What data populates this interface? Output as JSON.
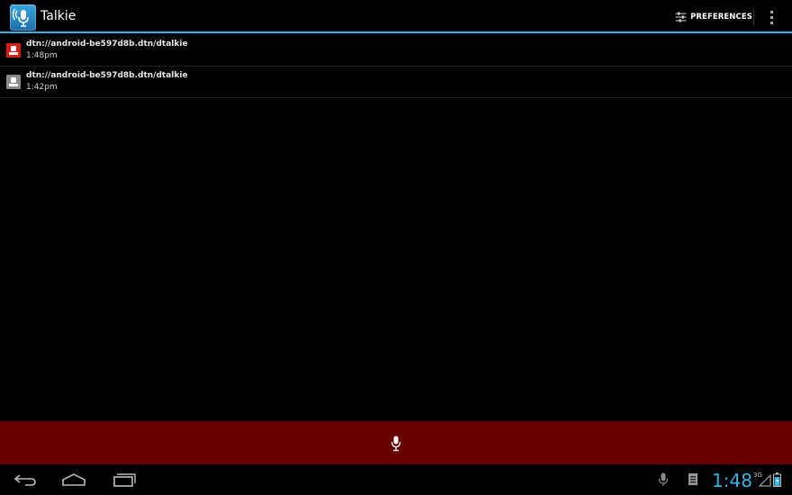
{
  "app": {
    "title": "Talkie",
    "icon": "talkie-mic-icon"
  },
  "actionbar": {
    "preferences_label": "PREFERENCES",
    "preferences_icon": "sliders-icon",
    "overflow_icon": "overflow-menu-icon"
  },
  "messages": [
    {
      "source": "dtn://android-be597d8b.dtn/dtalkie",
      "time": "1:48pm",
      "icon": "user-icon",
      "icon_color": "#d91a1a"
    },
    {
      "source": "dtn://android-be597d8b.dtn/dtalkie",
      "time": "1:42pm",
      "icon": "user-icon",
      "icon_color": "#8a8a8a"
    }
  ],
  "record_bar": {
    "icon": "microphone-icon",
    "color": "#660000"
  },
  "system_bar": {
    "nav": [
      "back-icon",
      "home-icon",
      "recent-apps-icon"
    ],
    "status_icons": [
      "microphone-icon",
      "notification-icon",
      "signal-icon",
      "battery-icon"
    ],
    "network": "3G",
    "clock": "1:48"
  },
  "accent_color": "#33b5e5"
}
